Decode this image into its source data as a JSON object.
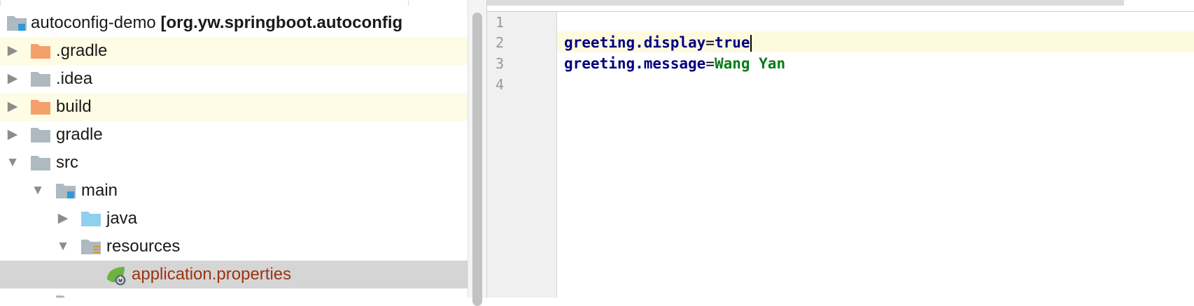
{
  "project_tree": {
    "root": {
      "name": "autoconfig-demo",
      "module_label": "[org.yw.springboot.autoconfig",
      "icon": "module-folder-icon"
    },
    "items": [
      {
        "label": "gradle_dir",
        "text": ".gradle",
        "icon": "excluded-folder-icon",
        "expanded": false
      },
      {
        "label": "idea_dir",
        "text": ".idea",
        "icon": "folder-icon",
        "expanded": false
      },
      {
        "label": "build_dir",
        "text": "build",
        "icon": "excluded-folder-icon",
        "expanded": false
      },
      {
        "label": "gradle",
        "text": "gradle",
        "icon": "folder-icon",
        "expanded": false
      },
      {
        "label": "src",
        "text": "src",
        "icon": "folder-icon",
        "expanded": true
      },
      {
        "label": "main",
        "text": "main",
        "icon": "source-root-folder-icon",
        "expanded": true
      },
      {
        "label": "java",
        "text": "java",
        "icon": "java-source-folder-icon",
        "expanded": false
      },
      {
        "label": "resources",
        "text": "resources",
        "icon": "resources-folder-icon",
        "expanded": true
      },
      {
        "label": "application_properties",
        "text": "application.properties",
        "icon": "spring-properties-file-icon",
        "selected": true
      }
    ]
  },
  "editor": {
    "line_numbers": [
      "1",
      "2",
      "3",
      "4"
    ],
    "lines": [
      {
        "key": "",
        "sep": "",
        "value": ""
      },
      {
        "key": "greeting.display",
        "sep": "=",
        "value": "true"
      },
      {
        "key": "greeting.message",
        "sep": "=",
        "value": "Wang Yan"
      },
      {
        "key": "",
        "sep": "",
        "value": ""
      }
    ]
  },
  "colors": {
    "key": "#000080",
    "value": "#067d17",
    "excluded_folder": "#f4a06b",
    "folder": "#aeb9c0",
    "selection": "#d5d5d5",
    "highlight_row": "#fefce4"
  }
}
